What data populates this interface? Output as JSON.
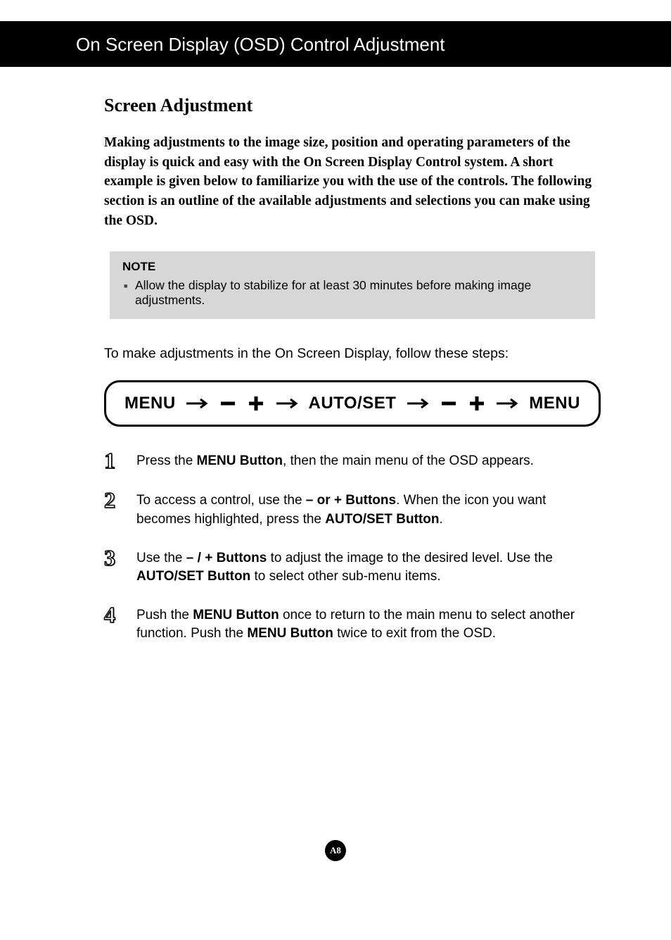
{
  "header": {
    "title": "On Screen Display (OSD) Control Adjustment"
  },
  "subhead": "Screen Adjustment",
  "intro": "Making adjustments to the image size, position and operating parameters of the display is quick and easy with the On Screen Display Control system. A short example is given below to familiarize you with the use of the controls. The following section is an outline of the available adjustments and selections you can make using the OSD.",
  "note": {
    "label": "NOTE",
    "text": "Allow the display to stabilize for at least 30 minutes before making image adjustments."
  },
  "lead": "To make adjustments in the On Screen Display, follow these steps:",
  "flow": {
    "a": "MENU",
    "b": "AUTO/SET",
    "c": "MENU"
  },
  "steps": {
    "s1": {
      "num": "1",
      "pre": "Press the ",
      "bold1": "MENU Button",
      "post": ", then the main menu of the OSD appears."
    },
    "s2": {
      "num": "2",
      "pre": "To access a control, use the   ",
      "bold1": "– or  + Buttons",
      "mid": ". When the icon you want becomes highlighted, press the ",
      "bold2": "AUTO/SET Button",
      "post": "."
    },
    "s3": {
      "num": "3",
      "pre": " Use the   ",
      "glyph1": "–",
      "slash": "    / ",
      "glyph2": "+",
      "mid": "  ",
      "bold1": "Buttons",
      "mid2": " to adjust the image to the desired level. Use the ",
      "bold2": "AUTO/SET Button",
      "post": " to select other sub-menu items."
    },
    "s4": {
      "num": "4",
      "pre": "Push the ",
      "bold1": "MENU Button",
      "mid": " once to return to the main menu to select another function. Push the ",
      "bold2": "MENU Button",
      "post": " twice to exit from the OSD."
    }
  },
  "page": "A8"
}
